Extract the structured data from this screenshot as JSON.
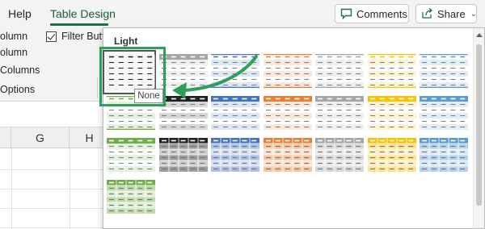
{
  "ribbon": {
    "tabs": [
      "Help",
      "Table Design"
    ],
    "active_tab": "Table Design",
    "comments_label": "Comments",
    "share_label": "Share",
    "options": {
      "header_column_partial": "olumn",
      "last_column_partial": "olumn",
      "banded_columns_partial": "Columns",
      "filter_button_partial": "Filter Butto",
      "group_label_partial": "Options"
    }
  },
  "sheet": {
    "column_headers": [
      "G",
      "H"
    ]
  },
  "gallery": {
    "section_title": "Light",
    "tooltip": "None",
    "colors": {
      "black": "#222222",
      "gray": "#a6a6a6",
      "blue": "#4472c4",
      "orange": "#ed7d31",
      "silver": "#a5a5a5",
      "gold": "#ffc000",
      "lightblue": "#5b9bd5",
      "green": "#70ad47",
      "accent_frame": "#2f9e5a"
    },
    "rows": [
      [
        "plain-black",
        "gray-header",
        "blue-light",
        "orange-light",
        "gray-light",
        "gold-light",
        "lightblue-light"
      ],
      [
        "green-light",
        "black-header",
        "blue-header",
        "orange-header",
        "gray-header-2",
        "gold-header",
        "lightblue-header"
      ],
      [
        "green-header",
        "black-grid",
        "blue-grid",
        "orange-grid",
        "gray-grid",
        "gold-grid",
        "lightblue-grid"
      ],
      [
        "green-grid"
      ]
    ]
  }
}
